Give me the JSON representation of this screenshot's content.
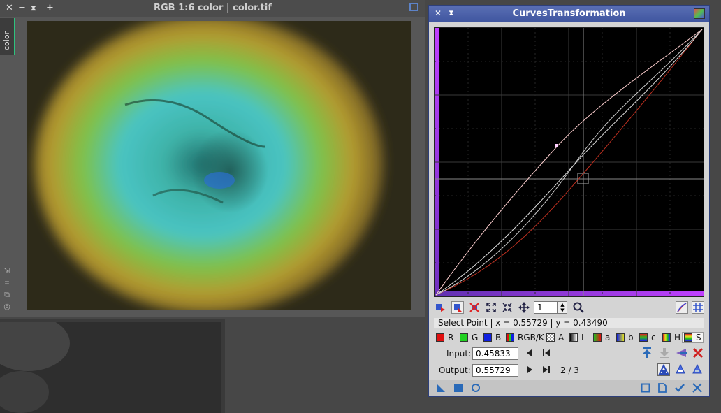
{
  "image_window": {
    "title": "RGB 1:6 color | color.tif",
    "tab_label": "color",
    "title_buttons": [
      "close-icon",
      "minimize-icon",
      "shade-icon",
      "maximize-icon"
    ]
  },
  "curves": {
    "title": "CurvesTransformation",
    "zoom_value": "1",
    "status_text": "Select Point | x = 0.55729 | y = 0.43490",
    "channels": [
      {
        "label": "R",
        "color": "#e01010"
      },
      {
        "label": "G",
        "color": "#20d020"
      },
      {
        "label": "B",
        "color": "#1020e0"
      },
      {
        "label": "RGB/K",
        "color": "#808080"
      },
      {
        "label": "A",
        "color": "#ffffff"
      },
      {
        "label": "L",
        "color": "#777777"
      },
      {
        "label": "a",
        "color": "#30a030"
      },
      {
        "label": "b",
        "color": "#2030a0"
      },
      {
        "label": "c",
        "color": "#30a060"
      },
      {
        "label": "H",
        "color": "#c06020"
      },
      {
        "label": "S",
        "color": "#30a030"
      }
    ],
    "selected_channel": "S",
    "input_label": "Input:",
    "input_value": "0.45833",
    "output_label": "Output:",
    "output_value": "0.55729",
    "point_counter": "2 / 3"
  }
}
